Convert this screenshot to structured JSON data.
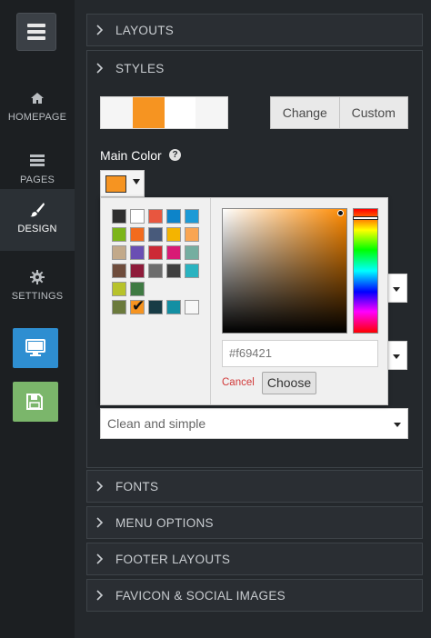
{
  "sidebar": {
    "items": [
      {
        "label": "HOMEPAGE",
        "icon": "home-icon"
      },
      {
        "label": "PAGES",
        "icon": "pages-icon"
      },
      {
        "label": "DESIGN",
        "icon": "brush-icon",
        "active": true
      },
      {
        "label": "SETTINGS",
        "icon": "gear-icon"
      }
    ],
    "tiles": [
      {
        "icon": "monitor-icon",
        "color": "#2e8ed1"
      },
      {
        "icon": "save-icon",
        "color": "#7bb66b"
      }
    ]
  },
  "sections": {
    "layouts": "LAYOUTS",
    "styles": "STYLES",
    "fonts": "FONTS",
    "menu_options": "MENU OPTIONS",
    "footer_layouts": "FOOTER LAYOUTS",
    "favicon": "FAVICON & SOCIAL IMAGES"
  },
  "styles": {
    "scheme_swatches": [
      "#f5f5f5",
      "#f69421",
      "#ffffff",
      "#f5f5f5"
    ],
    "change_label": "Change",
    "custom_label": "Custom",
    "main_color_label": "Main Color",
    "help_glyph": "?",
    "main_color_value": "#f69421",
    "style_select_value": "Clean and simple"
  },
  "color_picker": {
    "palette": [
      [
        "#2f2f2f",
        "#ffffff",
        "#e8563f",
        "#0d84c9",
        "#1c9ad6"
      ],
      [
        "#7cb518",
        "#f26b1d",
        "#485a7b",
        "#f4b400",
        "#f9a552"
      ],
      [
        "#c2a98a",
        "#6a4fb3",
        "#cc2a36",
        "#d81b75",
        "#74aea0"
      ],
      [
        "#6e4c3c",
        "#8e1b3a",
        "#6d6d6d",
        "#3f3f3f",
        "#2ab3c0"
      ],
      [
        "#b7c22a",
        "#3f7a43"
      ],
      [
        "#6b7a3c",
        "#f69421",
        "#173b45",
        "#138fa3",
        "#f7f7f7"
      ]
    ],
    "selected_row": 5,
    "selected_col": 1,
    "hex_value": "#f69421",
    "cancel_label": "Cancel",
    "choose_label": "Choose"
  },
  "colors": {
    "accent": "#f69421",
    "rail_bg": "#1c1f22",
    "panel_bg": "#24282c"
  }
}
